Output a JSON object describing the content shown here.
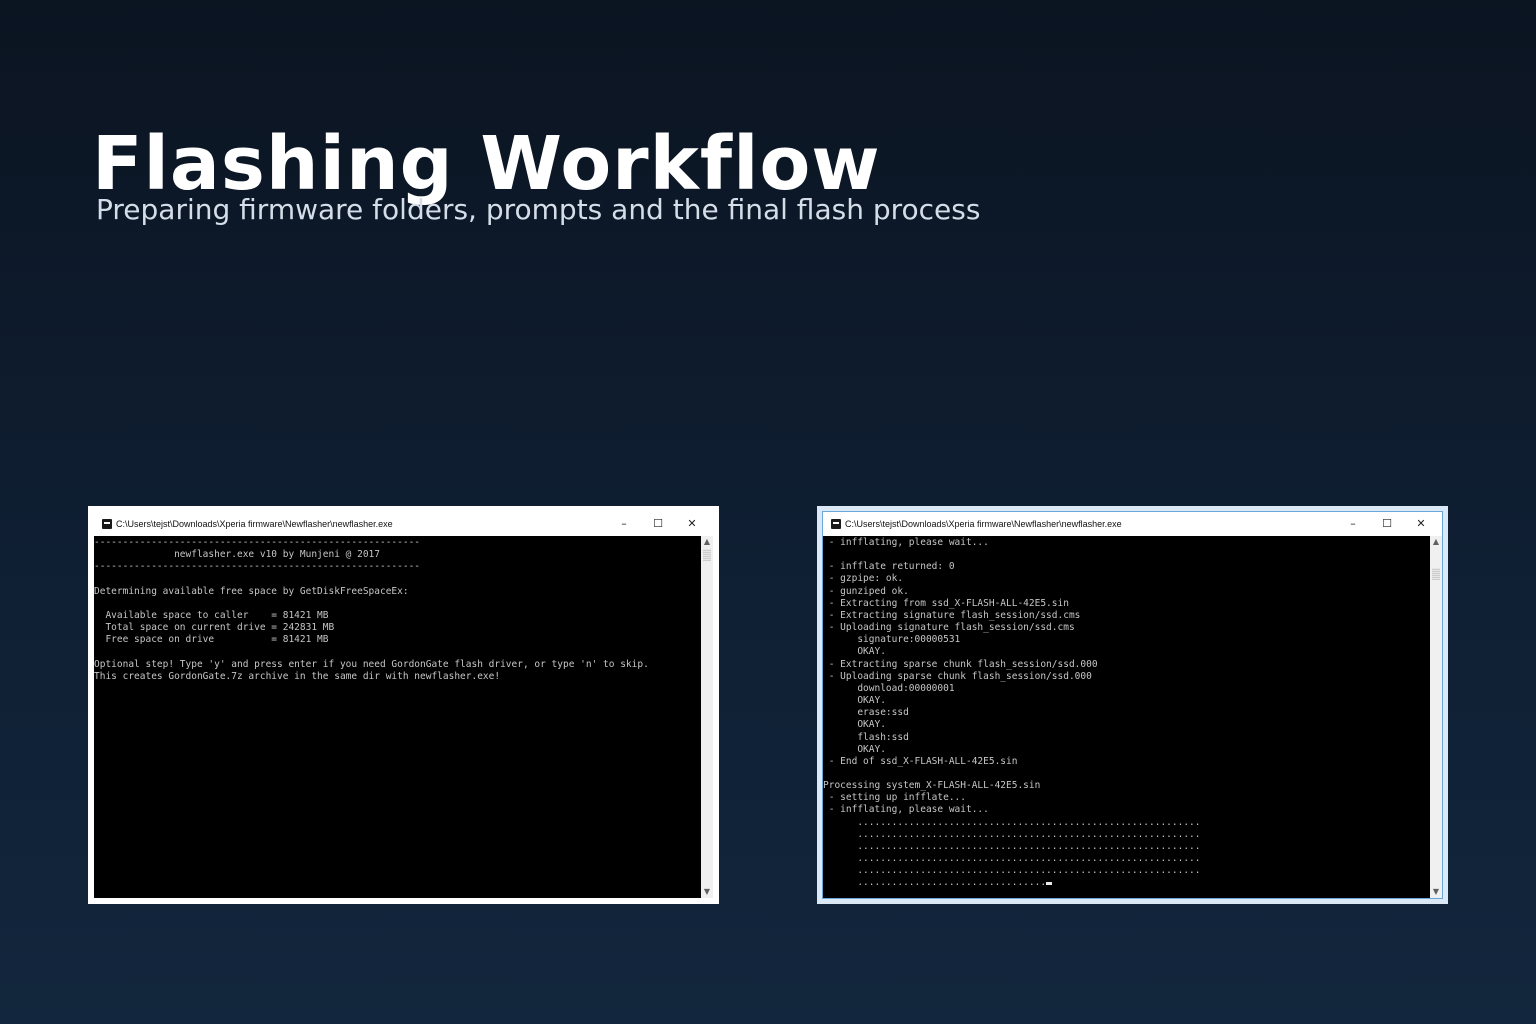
{
  "slide": {
    "title": "Flashing Workflow",
    "subtitle": "Preparing firmware folders, prompts and the final flash process"
  },
  "windows": [
    {
      "title": "C:\\Users\\tejst\\Downloads\\Xperia firmware\\Newflasher\\newflasher.exe",
      "controls": {
        "minimize": "–",
        "maximize": "☐",
        "close": "✕"
      },
      "console_text": "---------------------------------------------------------\n              newflasher.exe v10 by Munjeni @ 2017\n---------------------------------------------------------\n\nDetermining available free space by GetDiskFreeSpaceEx:\n\n  Available space to caller    = 81421 MB\n  Total space on current drive = 242831 MB\n  Free space on drive          = 81421 MB\n\nOptional step! Type 'y' and press enter if you need GordonGate flash driver, or type 'n' to skip.\nThis creates GordonGate.7z archive in the same dir with newflasher.exe!"
    },
    {
      "title": "C:\\Users\\tejst\\Downloads\\Xperia firmware\\Newflasher\\newflasher.exe",
      "controls": {
        "minimize": "–",
        "maximize": "☐",
        "close": "✕"
      },
      "console_text": " - infflating, please wait...\n\n - infflate returned: 0\n - gzpipe: ok.\n - gunziped ok.\n - Extracting from ssd_X-FLASH-ALL-42E5.sin\n - Extracting signature flash_session/ssd.cms\n - Uploading signature flash_session/ssd.cms\n      signature:00000531\n      OKAY.\n - Extracting sparse chunk flash_session/ssd.000\n - Uploading sparse chunk flash_session/ssd.000\n      download:00000001\n      OKAY.\n      erase:ssd\n      OKAY.\n      flash:ssd\n      OKAY.\n - End of ssd_X-FLASH-ALL-42E5.sin\n\nProcessing system_X-FLASH-ALL-42E5.sin\n - setting up infflate...\n - infflating, please wait...\n      ............................................................\n      ............................................................\n      ............................................................\n      ............................................................\n      ............................................................\n      ................................."
    }
  ],
  "icons": {
    "app": "console-app-icon",
    "scroll_up": "scroll-up-arrow-icon",
    "scroll_down": "scroll-down-arrow-icon"
  }
}
